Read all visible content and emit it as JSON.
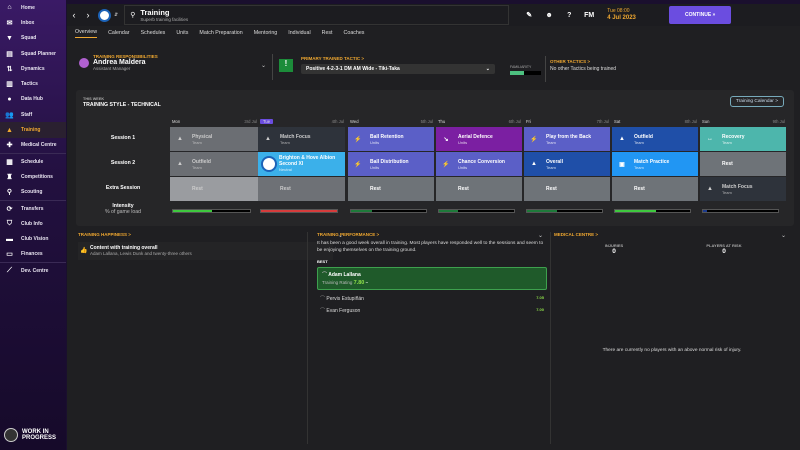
{
  "sidebar": {
    "items": [
      {
        "label": "Home",
        "icon": "home-icon",
        "glyph": "⌂"
      },
      {
        "label": "Inbox",
        "icon": "inbox-icon",
        "glyph": "✉"
      },
      {
        "label": "Squad",
        "icon": "shirt-icon",
        "glyph": "▼"
      },
      {
        "label": "Squad Planner",
        "icon": "planner-icon",
        "glyph": "▤"
      },
      {
        "label": "Dynamics",
        "icon": "dynamics-icon",
        "glyph": "⇅"
      },
      {
        "label": "Tactics",
        "icon": "tactics-icon",
        "glyph": "▥"
      },
      {
        "label": "Data Hub",
        "icon": "data-hub-icon",
        "glyph": "●"
      },
      {
        "label": "Staff",
        "icon": "staff-icon",
        "glyph": "👥"
      },
      {
        "label": "Training",
        "icon": "training-cone-icon",
        "glyph": "▲",
        "active": true
      },
      {
        "label": "Medical Centre",
        "icon": "medical-icon",
        "glyph": "✚"
      },
      {
        "label": "Schedule",
        "icon": "calendar-icon",
        "glyph": "▦"
      },
      {
        "label": "Competitions",
        "icon": "trophy-icon",
        "glyph": "♜"
      },
      {
        "label": "Scouting",
        "icon": "magnifier-icon",
        "glyph": "⚲"
      },
      {
        "label": "Transfers",
        "icon": "transfers-icon",
        "glyph": "⟳"
      },
      {
        "label": "Club Info",
        "icon": "shield-icon",
        "glyph": "⛉"
      },
      {
        "label": "Club Vision",
        "icon": "briefcase-icon",
        "glyph": "▬"
      },
      {
        "label": "Finances",
        "icon": "money-icon",
        "glyph": "▭"
      },
      {
        "label": "Dev. Centre",
        "icon": "dev-centre-icon",
        "glyph": "⟋"
      }
    ],
    "badge": "WORK IN PROGRESS"
  },
  "header": {
    "title": "Training",
    "subtitle": "Superb training facilities",
    "date_time": "Tue 08:00",
    "date": "4 Jul 2023",
    "continue": "CONTINUE",
    "fm": "FM"
  },
  "tabs": [
    "Overview",
    "Calendar",
    "Schedules",
    "Units",
    "Match Preparation",
    "Mentoring",
    "Individual",
    "Rest",
    "Coaches"
  ],
  "responsibilities": {
    "heading": "TRAINING RESPONSIBILITIES",
    "name": "Andrea Maldera",
    "role": "Assistant Manager"
  },
  "tactic": {
    "heading": "PRIMARY TRAINED TACTIC >",
    "selected": "Positive 4-2-3-1 DM AM Wide - Tiki-Taka",
    "familiarity_label": "FAMILIARITY",
    "familiarity": 0.45
  },
  "other_tactics": {
    "heading": "OTHER TACTICS >",
    "text": "No other Tactics being trained"
  },
  "week": {
    "label": "THIS WEEK",
    "style": "TRAINING STYLE - TECHNICAL",
    "calendar_button": "Training Calendar >",
    "rows": [
      "Session 1",
      "Session 2",
      "Extra Session",
      "Intensity",
      "% of game load"
    ],
    "days": [
      {
        "day": "Mon",
        "date": "3rd Jul",
        "sessions": [
          {
            "t": "Physical",
            "s": "Team",
            "c": "#6b6e73",
            "i": "▲",
            "dim": true
          },
          {
            "t": "Outfield",
            "s": "Team",
            "c": "#6b6e73",
            "i": "▲",
            "dim": true
          },
          {
            "t": "Rest",
            "c": "#9a9ca0",
            "dim": true
          }
        ],
        "intensity": 0.5,
        "ic": "#3ec83e"
      },
      {
        "day": "Tue",
        "date": "4th Jul",
        "today": true,
        "sessions": [
          {
            "t": "Match Focus",
            "s": "Team",
            "c": "#2e333b",
            "i": "▲",
            "dim": true
          },
          {
            "t": "Brighton & Hove Albion Second XI",
            "s": "Neutral",
            "c": "#3bb0ea",
            "crest": true
          },
          {
            "t": "Rest",
            "c": "#6e7176",
            "dim": true
          }
        ],
        "intensity": 1.0,
        "ic": "#d63c3c"
      },
      {
        "day": "Wed",
        "date": "5th Jul",
        "sessions": [
          {
            "t": "Ball Retention",
            "s": "Units",
            "c": "#5b5fc7",
            "i": "⚡"
          },
          {
            "t": "Ball Distribution",
            "s": "Units",
            "c": "#5b5fc7",
            "i": "⚡"
          },
          {
            "t": "Rest",
            "c": "#6e7378"
          }
        ],
        "intensity": 0.28,
        "ic": "#1e7a3a"
      },
      {
        "day": "Thu",
        "date": "6th Jul",
        "sessions": [
          {
            "t": "Aerial Defence",
            "s": "Units",
            "c": "#7b1fa2",
            "i": "↘"
          },
          {
            "t": "Chance Conversion",
            "s": "Units",
            "c": "#5b5fc7",
            "i": "⚡"
          },
          {
            "t": "Rest",
            "c": "#6e7378"
          }
        ],
        "intensity": 0.25,
        "ic": "#1e7a3a"
      },
      {
        "day": "Fri",
        "date": "7th Jul",
        "sessions": [
          {
            "t": "Play from the Back",
            "s": "Team",
            "c": "#5b5fc7",
            "i": "⚡"
          },
          {
            "t": "Overall",
            "s": "Team",
            "c": "#1f4fa8",
            "i": "▲"
          },
          {
            "t": "Rest",
            "c": "#6e7378"
          }
        ],
        "intensity": 0.4,
        "ic": "#1e7a3a"
      },
      {
        "day": "Sat",
        "date": "8th Jul",
        "sessions": [
          {
            "t": "Outfield",
            "s": "Team",
            "c": "#1f4fa8",
            "i": "▲"
          },
          {
            "t": "Match Practice",
            "s": "Team",
            "c": "#2196f3",
            "i": "▣"
          },
          {
            "t": "Rest",
            "c": "#6e7378"
          }
        ],
        "intensity": 0.55,
        "ic": "#3ec83e"
      },
      {
        "day": "Sun",
        "date": "9th Jul",
        "sessions": [
          {
            "t": "Recovery",
            "s": "Team",
            "c": "#4db6ac",
            "i": "↔"
          },
          {
            "t": "Rest",
            "c": "#6e7378"
          },
          {
            "t": "Match Focus",
            "s": "Team",
            "c": "#2e333b",
            "i": "▲",
            "dim": true
          }
        ],
        "intensity": 0.05,
        "ic": "#1c3a8c"
      }
    ]
  },
  "happiness": {
    "heading": "TRAINING HAPPINESS >",
    "status": "Content with training overall",
    "players": "Adam Lallana, Lewis Dunk and twenty-three others"
  },
  "performance": {
    "heading": "TRAINING PERFORMANCE >",
    "text": "It has been a good week overall in training. Most players have responded well to the sessions and seem to be enjoying themselves on the training ground.",
    "best_label": "BEST",
    "best": {
      "name": "Adam Lallana",
      "rating_label": "Training Rating",
      "rating": "7.80",
      "trend": "–"
    },
    "others": [
      {
        "name": "Pervis Estupiñán",
        "rating": "7.05"
      },
      {
        "name": "Evan Ferguson",
        "rating": "7.00"
      }
    ]
  },
  "medical": {
    "heading": "MEDICAL CENTRE >",
    "injuries_label": "INJURIES",
    "injuries": "0",
    "risk_label": "PLAYERS AT RISK",
    "risk": "0",
    "message": "There are currently no players with an above normal risk of injury."
  },
  "colors": {
    "accent": "#f0a830",
    "continue": "#6b4de0"
  }
}
